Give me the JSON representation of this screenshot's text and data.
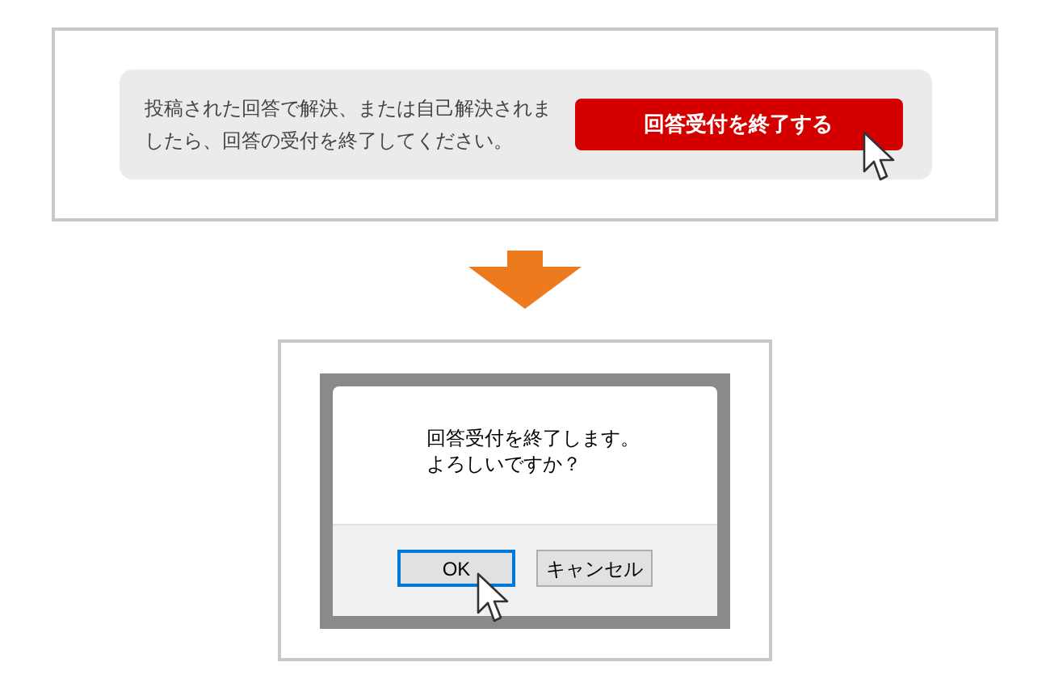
{
  "panel": {
    "message": "投稿された回答で解決、または自己解決されましたら、回答の受付を終了してください。",
    "button": "回答受付を終了する"
  },
  "dialog": {
    "message_lines": [
      "回答受付を終了します。",
      "よろしいですか？"
    ],
    "buttons": [
      {
        "label": "OK",
        "focused": true
      },
      {
        "label": "キャンセル",
        "focused": false
      }
    ]
  }
}
